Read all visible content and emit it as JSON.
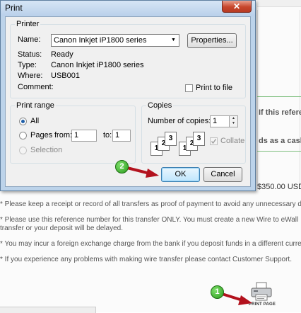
{
  "background": {
    "note_reference": "If this refere",
    "note_cash": "ds as a cash c",
    "amount": "$350.00 USD",
    "notes": [
      "* Please keep a receipt or record of all transfers as proof of payment to avoid any unnecessary de",
      "* Please use this reference number for this transfer ONLY. You must create a new Wire to eWall",
      "transfer or your deposit will be delayed.",
      "* You may incur a foreign exchange charge from the bank if you deposit funds in a different curre",
      "* If you experience any problems with making wire transfer please contact Customer Support."
    ],
    "print_page_label": "PRINT PAGE",
    "printer_icon": "printer-icon"
  },
  "dialog": {
    "title": "Print",
    "close_glyph": "✕",
    "printer_group": {
      "title": "Printer",
      "name_label": "Name:",
      "name_value": "Canon Inkjet iP1800 series",
      "properties_label": "Properties...",
      "status_label": "Status:",
      "status_value": "Ready",
      "type_label": "Type:",
      "type_value": "Canon Inkjet iP1800 series",
      "where_label": "Where:",
      "where_value": "USB001",
      "comment_label": "Comment:",
      "print_to_file_label": "Print to file"
    },
    "range_group": {
      "title": "Print range",
      "all_label": "All",
      "pages_label": "Pages",
      "from_label": "from:",
      "from_value": "1",
      "to_label": "to:",
      "to_value": "1",
      "selection_label": "Selection"
    },
    "copies_group": {
      "title": "Copies",
      "number_label": "Number of copies:",
      "number_value": "1",
      "collate_label": "Collate",
      "collate_pages_a": [
        "1",
        "2",
        "3"
      ],
      "collate_pages_b": [
        "1",
        "2",
        "3"
      ]
    },
    "ok_label": "OK",
    "cancel_label": "Cancel"
  },
  "markers": {
    "step_one": "1",
    "step_two": "2"
  },
  "colors": {
    "arrow": "#b3121d",
    "marker": "#3fae2a",
    "dialog_frame": "#bcd3ea",
    "close_button": "#c7462c"
  }
}
